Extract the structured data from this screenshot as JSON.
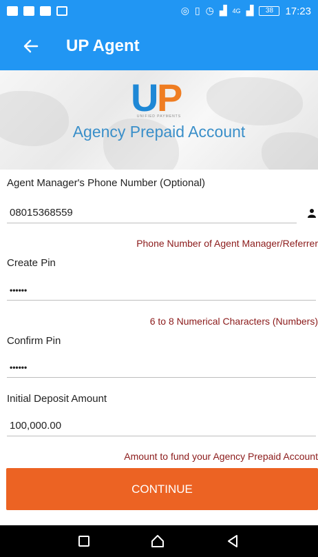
{
  "status_bar": {
    "time": "17:23",
    "battery": "38",
    "network": "4G",
    "icons_left": [
      "gallery-icon",
      "message-icon",
      "youtube-icon",
      "image-icon"
    ],
    "icons_right": [
      "location-icon",
      "vibrate-icon",
      "alarm-icon",
      "signal-icon",
      "network-signal-icon",
      "battery-icon"
    ]
  },
  "app_bar": {
    "title": "UP Agent",
    "back_icon": "arrow-left-icon"
  },
  "banner": {
    "logo_text_u": "U",
    "logo_text_p": "P",
    "logo_subtext": "UNIFIED PAYMENTS",
    "title": "Agency Prepaid Account"
  },
  "form": {
    "manager_phone": {
      "label": "Agent Manager's Phone Number (Optional)",
      "value": "08015368559",
      "hint": "Phone Number of Agent Manager/Referrer",
      "icon": "person-icon"
    },
    "create_pin": {
      "label": "Create Pin",
      "value": "••••••",
      "hint": "6 to 8 Numerical Characters (Numbers)"
    },
    "confirm_pin": {
      "label": "Confirm Pin",
      "value": "••••••"
    },
    "initial_deposit": {
      "label": "Initial Deposit Amount",
      "value": "100,000.00",
      "hint": "Amount to fund your Agency Prepaid Account"
    }
  },
  "continue_button": {
    "label": "CONTINUE",
    "color": "#ec6323"
  },
  "colors": {
    "primary": "#2196f3",
    "hint_text": "#8b1a1a",
    "logo_blue": "#1e88d6",
    "logo_orange": "#ef7d22"
  },
  "nav_bar": {
    "icons": [
      "recent-apps-icon",
      "home-icon",
      "back-icon"
    ]
  }
}
